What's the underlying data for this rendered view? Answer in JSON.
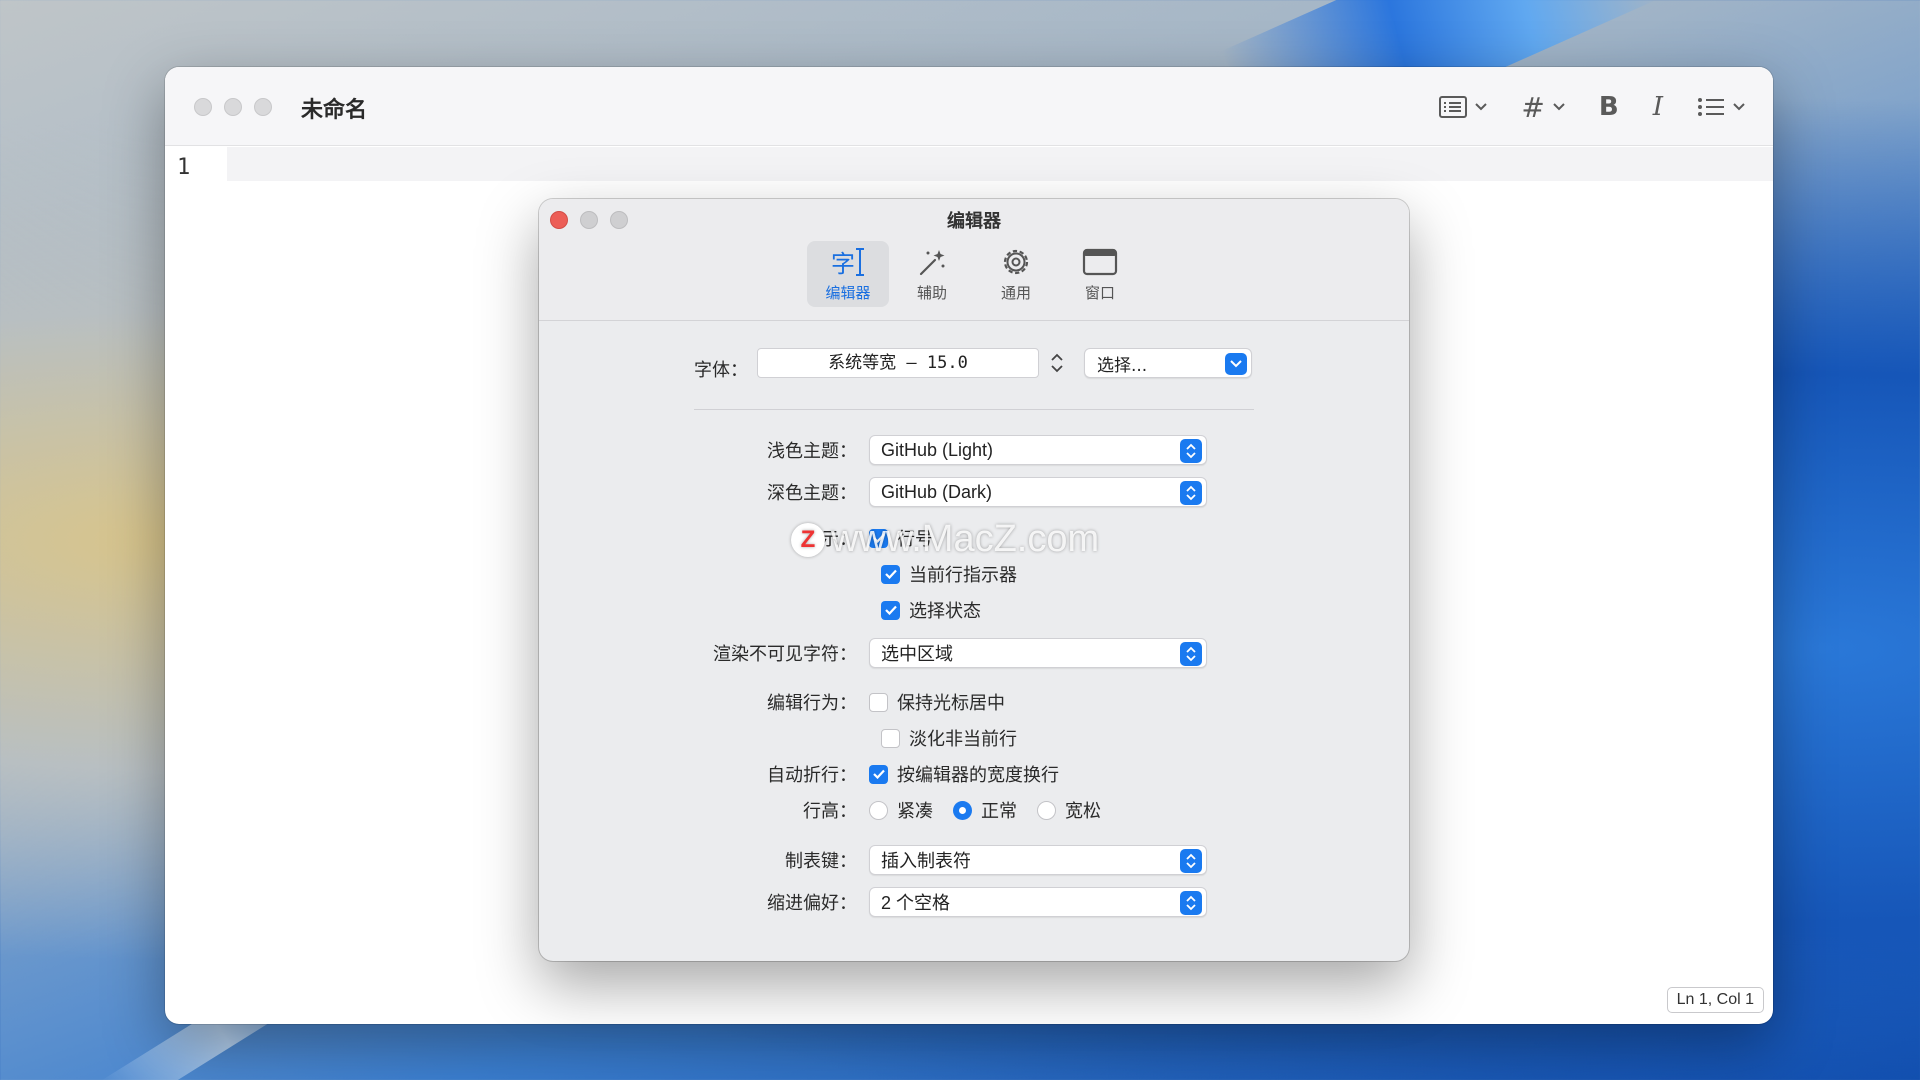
{
  "main_window": {
    "title": "未命名",
    "line_number": "1",
    "status": "Ln 1, Col 1",
    "toolbar": {
      "bold_label": "B",
      "italic_label": "I",
      "heading_label": "#"
    }
  },
  "prefs": {
    "title": "编辑器",
    "tabs": [
      {
        "label": "编辑器",
        "icon": "font-cursor-icon",
        "active": true
      },
      {
        "label": "辅助",
        "icon": "magic-wand-icon",
        "active": false
      },
      {
        "label": "通用",
        "icon": "gear-icon",
        "active": false
      },
      {
        "label": "窗口",
        "icon": "window-icon",
        "active": false
      }
    ],
    "editor_tab_glyph": "字",
    "font": {
      "label": "字体：",
      "value": "系统等宽 – 15.0",
      "choose_label": "选择..."
    },
    "light_theme": {
      "label": "浅色主题：",
      "value": "GitHub (Light)"
    },
    "dark_theme": {
      "label": "深色主题：",
      "value": "GitHub (Dark)"
    },
    "display": {
      "label": "显示：",
      "options": [
        {
          "label": "行号",
          "checked": true
        },
        {
          "label": "当前行指示器",
          "checked": true
        },
        {
          "label": "选择状态",
          "checked": true
        }
      ]
    },
    "invisibles": {
      "label": "渲染不可见字符：",
      "value": "选中区域"
    },
    "edit_behavior": {
      "label": "编辑行为：",
      "options": [
        {
          "label": "保持光标居中",
          "checked": false
        },
        {
          "label": "淡化非当前行",
          "checked": false
        }
      ]
    },
    "wrap": {
      "label": "自动折行：",
      "option": "按编辑器的宽度换行",
      "checked": true
    },
    "line_height": {
      "label": "行高：",
      "options": [
        "紧凑",
        "正常",
        "宽松"
      ],
      "selected": "正常"
    },
    "tab_key": {
      "label": "制表键：",
      "value": "插入制表符"
    },
    "indent": {
      "label": "缩进偏好：",
      "value": "2 个空格"
    }
  },
  "watermark": {
    "logo": "Z",
    "text": "www.MacZ.com"
  },
  "colors": {
    "accent": "#1a7af0",
    "close": "#ec5e57"
  }
}
